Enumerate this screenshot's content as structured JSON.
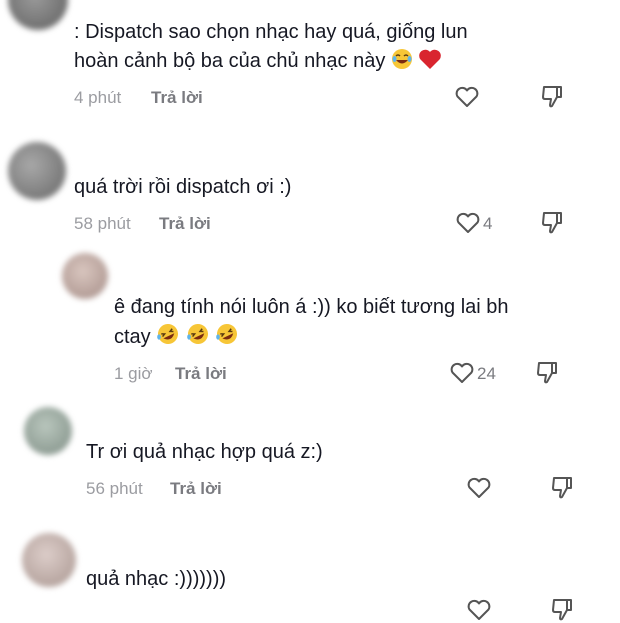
{
  "comments": [
    {
      "text_line1": ": Dispatch sao chọn nhạc hay quá, giống lun",
      "text_line2": "hoàn cảnh bộ ba của chủ nhạc này",
      "emojis": [
        "laughing-tears-emoji",
        "red-heart-emoji"
      ],
      "time": "4 phút",
      "reply_label": "Trả lời",
      "likes": ""
    },
    {
      "text_line1": "quá trời rồi dispatch ơi :)",
      "time": "58 phút",
      "reply_label": "Trả lời",
      "likes": "4"
    },
    {
      "text_line1": "ê đang tính nói luôn á :)) ko biết tương lai bh",
      "text_line2": "ctay",
      "emojis": [
        "rofl-emoji",
        "rofl-emoji",
        "rofl-emoji"
      ],
      "time": "1 giờ",
      "reply_label": "Trả lời",
      "likes": "24"
    },
    {
      "text_line1": "Tr ơi quả nhạc hợp quá z:)",
      "time": "56 phút",
      "reply_label": "Trả lời",
      "likes": ""
    },
    {
      "text_line1": "quả nhạc :)))))))",
      "time": "",
      "reply_label": "",
      "likes": ""
    }
  ],
  "icons": {
    "like": "heart-outline-icon",
    "dislike": "thumbs-down-outline-icon"
  },
  "colors": {
    "text": "#161823",
    "meta": "#9b9ca1",
    "reply": "#7a7b80"
  }
}
